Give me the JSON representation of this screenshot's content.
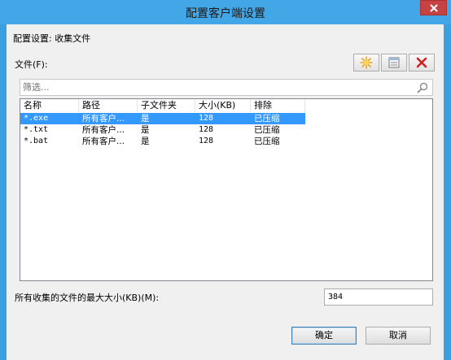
{
  "window": {
    "title": "配置客户端设置"
  },
  "config": {
    "setting_label": "配置设置: 收集文件",
    "files_label": "文件(F):"
  },
  "toolbar": {
    "new_icon": "star-burst-icon",
    "edit_icon": "properties-icon",
    "delete_icon": "red-x-icon"
  },
  "filter": {
    "placeholder": "筛选..."
  },
  "file_list": {
    "columns": [
      "名称",
      "路径",
      "子文件夹",
      "大小(KB)",
      "排除"
    ],
    "rows": [
      {
        "name": "*.exe",
        "path": "所有客户...",
        "subfolders": "是",
        "size": "128",
        "exclude": "已压缩",
        "selected": true
      },
      {
        "name": "*.txt",
        "path": "所有客户...",
        "subfolders": "是",
        "size": "128",
        "exclude": "已压缩",
        "selected": false
      },
      {
        "name": "*.bat",
        "path": "所有客户...",
        "subfolders": "是",
        "size": "128",
        "exclude": "已压缩",
        "selected": false
      }
    ]
  },
  "max_size": {
    "label": "所有收集的文件的最大大小(KB)(M):",
    "value": "384"
  },
  "buttons": {
    "ok": "确定",
    "cancel": "取消"
  },
  "colors": {
    "title_bar": "#43a6e6",
    "selection": "#3399ff",
    "close_button": "#c74343"
  }
}
